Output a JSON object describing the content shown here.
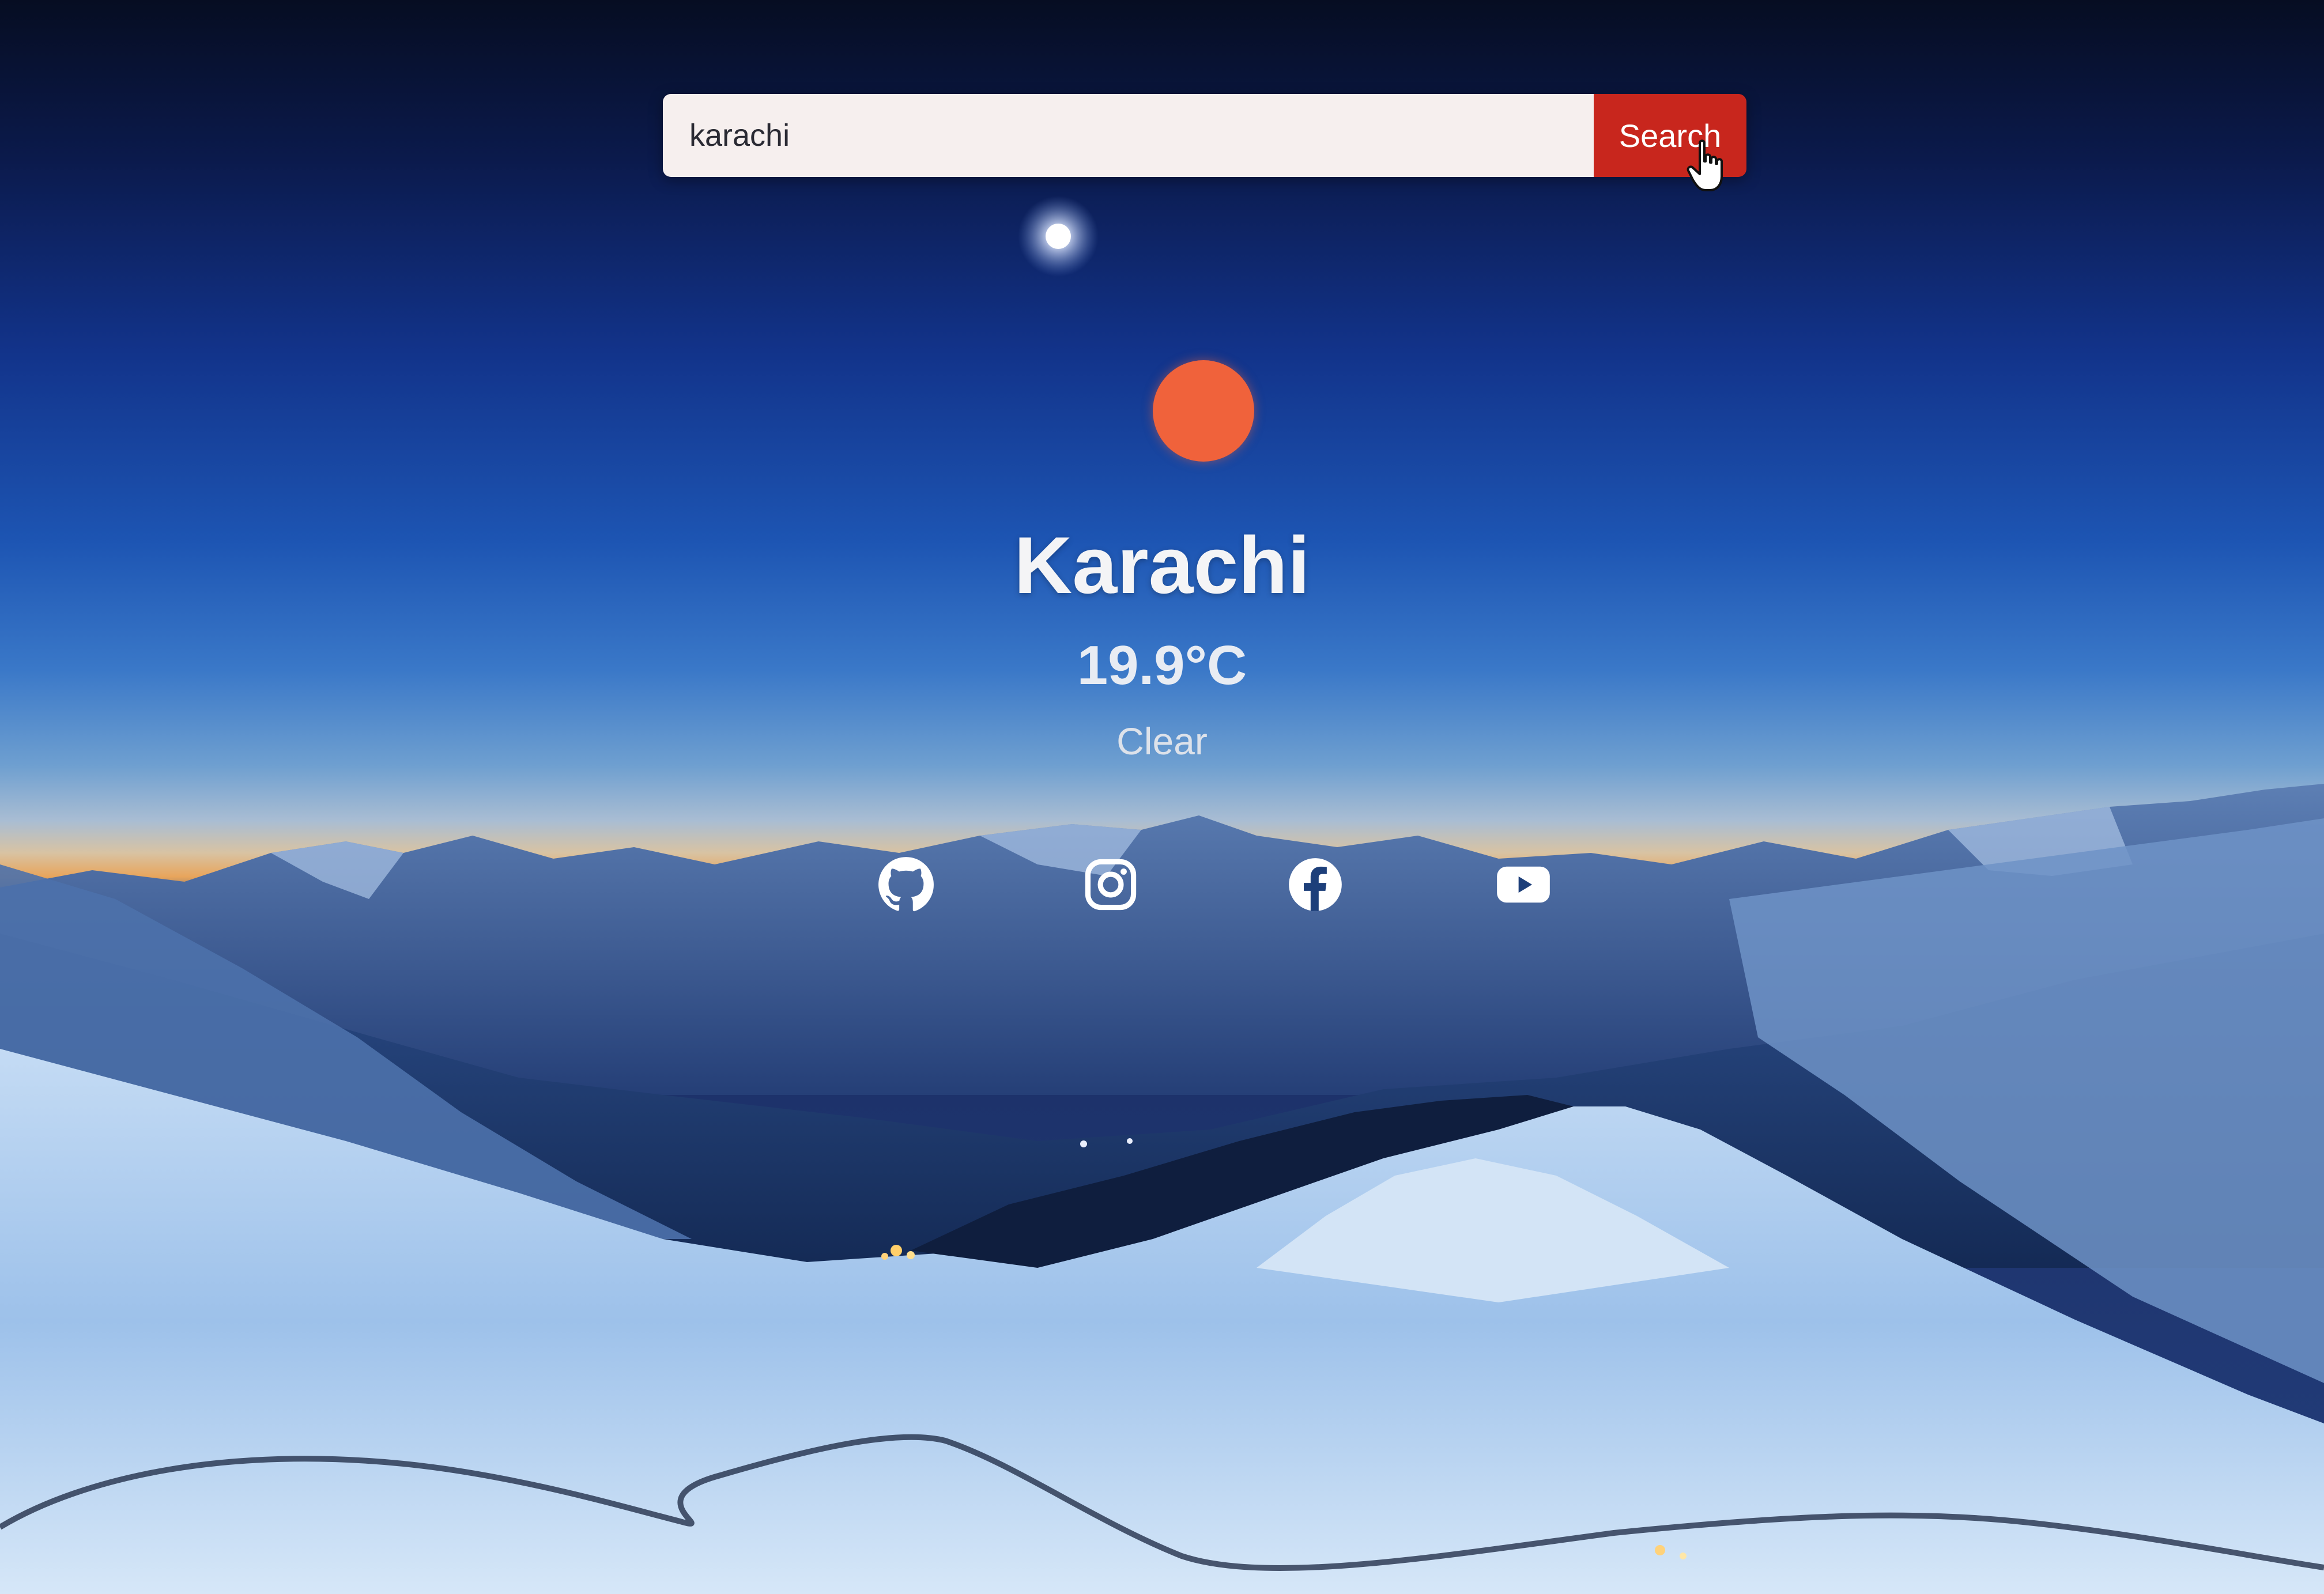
{
  "search": {
    "value": "karachi",
    "button_label": "Search"
  },
  "weather": {
    "city": "Karachi",
    "temperature": "19.9°C",
    "condition": "Clear",
    "icon": "sun-icon",
    "icon_color": "#f0623b"
  },
  "social_links": [
    {
      "icon": "github-icon"
    },
    {
      "icon": "instagram-icon"
    },
    {
      "icon": "facebook-icon"
    },
    {
      "icon": "youtube-icon"
    }
  ],
  "colors": {
    "search_button": "#c8261d",
    "search_field": "#f6efee",
    "text": "#f4f4f6"
  }
}
